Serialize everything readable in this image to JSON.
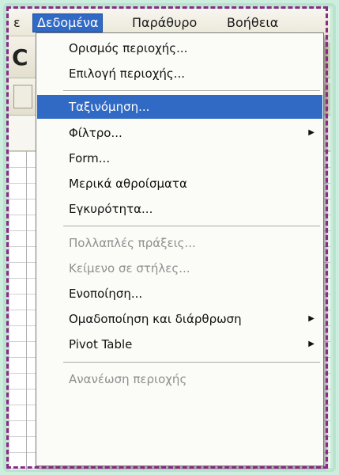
{
  "menubar": {
    "items": [
      {
        "label": "ε",
        "active": false
      },
      {
        "label": "Δεδομένα",
        "active": true
      },
      {
        "label": "Παράθυρο",
        "active": false
      },
      {
        "label": "Βοήθεια",
        "active": false
      }
    ]
  },
  "menu": {
    "items": [
      {
        "label": "Ορισμός περιοχής...",
        "disabled": false,
        "submenu": false
      },
      {
        "label": "Επιλογή περιοχής...",
        "disabled": false,
        "submenu": false
      },
      {
        "label": "Ταξινόμηση...",
        "disabled": false,
        "highlighted": true,
        "submenu": false
      },
      {
        "label": "Φίλτρο...",
        "disabled": false,
        "submenu": true
      },
      {
        "label": "Form...",
        "disabled": false,
        "submenu": false
      },
      {
        "label": "Μερικά αθροίσματα",
        "disabled": false,
        "submenu": false
      },
      {
        "label": "Εγκυρότητα...",
        "disabled": false,
        "submenu": false
      },
      {
        "label": "Πολλαπλές πράξεις...",
        "disabled": true,
        "submenu": false
      },
      {
        "label": "Κείμενο σε στήλες...",
        "disabled": true,
        "submenu": false
      },
      {
        "label": "Ενοποίηση...",
        "disabled": false,
        "submenu": false
      },
      {
        "label": "Ομαδοποίηση και διάρθρωση",
        "disabled": false,
        "submenu": true
      },
      {
        "label": "Pivot Table",
        "disabled": false,
        "submenu": true
      },
      {
        "label": "Ανανέωση περιοχής",
        "disabled": true,
        "submenu": false
      }
    ]
  },
  "toolbar": {
    "partial_letter": "C"
  },
  "colors": {
    "highlight": "#316ac5",
    "border_dash": "#8a2a86",
    "frame_bg": "#c9ecd9"
  }
}
